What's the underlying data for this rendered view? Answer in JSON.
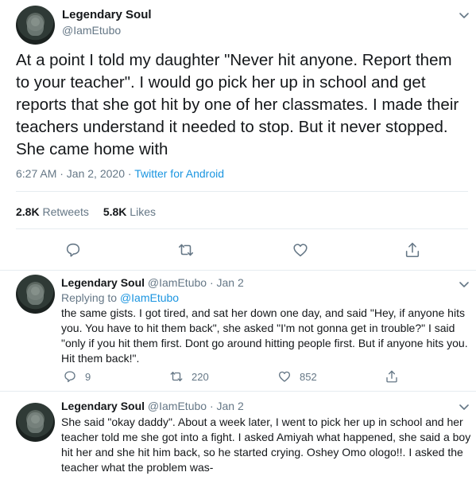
{
  "tweet": {
    "author_name": "Legendary Soul",
    "author_handle": "@IamEtubo",
    "text": "At a point I told my daughter \"Never hit anyone. Report them to your teacher\". I would go pick her up in school and get reports that she got hit by one of her classmates. I made their teachers understand it needed to stop. But it never stopped. She came home with",
    "timestamp": "6:27 AM · Jan 2, 2020",
    "separator": " · ",
    "source": "Twitter for Android",
    "retweets_count": "2.8K",
    "retweets_label": "Retweets",
    "likes_count": "5.8K",
    "likes_label": "Likes"
  },
  "replies": [
    {
      "author_name": "Legendary Soul",
      "author_handle": "@IamEtubo",
      "date": "· Jan 2",
      "replying_prefix": "Replying to",
      "replying_to": "@IamEtubo",
      "text": "the same gists. I got tired, and sat her down one day, and said \"Hey, if anyone hits you. You have to hit them back\", she  asked \"I'm not gonna get in trouble?\" I said \"only if you hit them first. Dont go around hitting people first. But if anyone hits you. Hit them back!\".",
      "reply_count": "9",
      "retweet_count": "220",
      "like_count": "852"
    },
    {
      "author_name": "Legendary Soul",
      "author_handle": "@IamEtubo",
      "date": "· Jan 2",
      "text": "She said \"okay daddy\". About a week later, I went to pick her up in school and her teacher told me she got into a fight. I asked Amiyah what happened, she said a boy hit her and she hit him back, so he started crying. Oshey Omo ologo!!. I asked the teacher what the problem was-"
    }
  ],
  "icons": {
    "reply": "reply-icon",
    "retweet": "retweet-icon",
    "like": "heart-icon",
    "share": "share-icon",
    "more": "chevron-down-icon"
  },
  "colors": {
    "text": "#14171a",
    "secondary": "#657786",
    "link": "#1b95e0",
    "divider": "#e6ecf0"
  }
}
